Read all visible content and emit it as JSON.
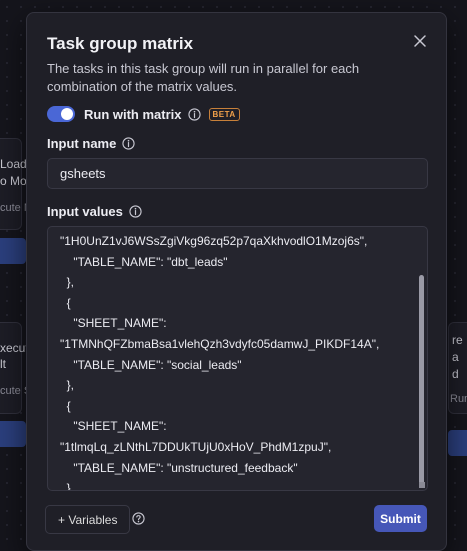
{
  "background": {
    "left_node_1": {
      "line1": "Loads",
      "line2": "o Mot",
      "sub": "cute M"
    },
    "left_node_2": {
      "line1": "xecut",
      "line2": "lt",
      "sub": "cute S"
    },
    "right_node": {
      "line1": "re",
      "line2": "a",
      "line3": "d",
      "sub": "Run"
    }
  },
  "modal": {
    "title": "Task group matrix",
    "description": "The tasks in this task group will run in parallel for each combination of the matrix values.",
    "toggle_label": "Run with matrix",
    "toggle_on": true,
    "beta_badge": "BETA",
    "input_name_label": "Input name",
    "input_name_value": "gsheets",
    "input_values_label": "Input values",
    "input_values_text": "\"1H0UnZ1vJ6WSsZgiVkg96zq52p7qaXkhvodlO1Mzoj6s\",\n    \"TABLE_NAME\": \"dbt_leads\"\n  },\n  {\n    \"SHEET_NAME\":\n\"1TMNhQFZbmaBsa1vlehQzh3vdyfc05damwJ_PIKDF14A\",\n    \"TABLE_NAME\": \"social_leads\"\n  },\n  {\n    \"SHEET_NAME\":\n\"1tlmqLq_zLNthL7DDUkTUjU0xHoV_PhdM1zpuJ\",\n    \"TABLE_NAME\": \"unstructured_feedback\"\n  }\n]",
    "variables_button": "+ Variables",
    "submit_button": "Submit"
  },
  "colors": {
    "accent": "#4a67d6",
    "submit": "#4657b8",
    "beta": "#f0a04a"
  }
}
